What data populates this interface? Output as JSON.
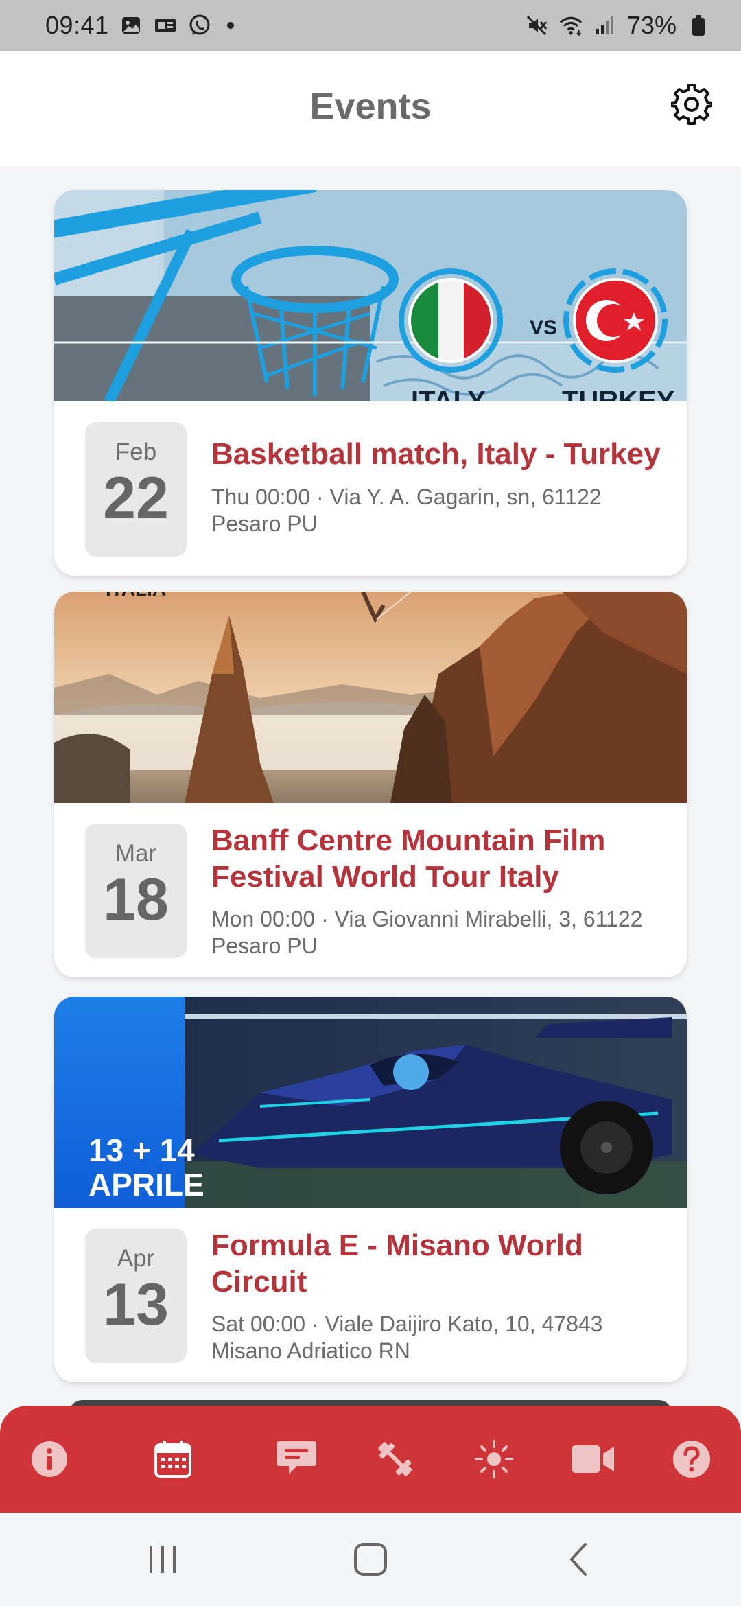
{
  "status_bar": {
    "time": "09:41",
    "battery_pct": "73%",
    "left_icons": [
      "image-icon",
      "ticket-icon",
      "whatsapp-icon",
      "dot-icon"
    ],
    "right_icons": [
      "mute-icon",
      "wifi-icon",
      "signal-icon",
      "battery-icon"
    ]
  },
  "header": {
    "title": "Events",
    "settings_icon": "gear-icon"
  },
  "events": [
    {
      "month": "Feb",
      "day": "22",
      "title": "Basketball match, Italy - Turkey",
      "meta": "Thu 00:00 · Via Y. A. Gagarin, sn, 61122 Pesaro PU",
      "image": {
        "vs": "VS",
        "left_team": "ITALY",
        "right_team": "TURKEY"
      }
    },
    {
      "month": "Mar",
      "day": "18",
      "title": "Banff Centre Mountain Film Festival World Tour Italy",
      "meta": "Mon 00:00 · Via Giovanni Mirabelli, 3, 61122 Pesaro PU",
      "image": {
        "caption": "ITALIA"
      }
    },
    {
      "month": "Apr",
      "day": "13",
      "title": "Formula E - Misano World Circuit",
      "meta": "Sat 00:00 · Viale Daijiro Kato, 10, 47843 Misano Adriatico RN",
      "image": {
        "dates_line1": "13 + 14",
        "dates_line2": "APRILE"
      }
    }
  ],
  "tab_bar": {
    "tabs": [
      "info-icon",
      "calendar-icon",
      "chat-icon",
      "dumbbell-icon",
      "sun-icon",
      "video-icon",
      "help-icon"
    ],
    "active": "calendar-icon"
  },
  "system_nav": [
    "recents-button",
    "home-button",
    "back-button"
  ],
  "colors": {
    "accent": "#cf3538",
    "title_red": "#b5333a",
    "status_bar": "#c2c2c2"
  }
}
